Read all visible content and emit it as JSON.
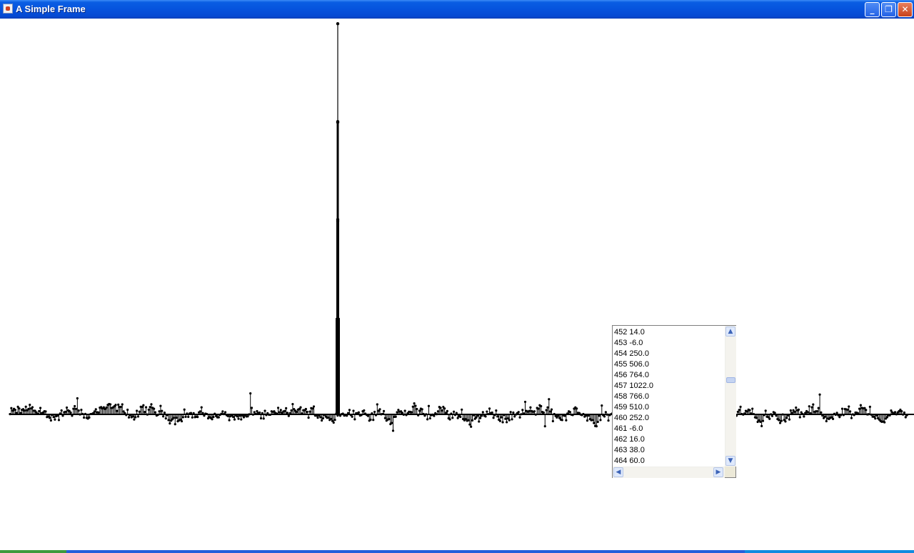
{
  "window": {
    "title": "A Simple Frame",
    "icon": "java-cup-icon",
    "controls": {
      "minimize": "_",
      "maximize": "❐",
      "close": "✕"
    }
  },
  "list": {
    "items": [
      "452 14.0",
      "453 -6.0",
      "454 250.0",
      "455 506.0",
      "456 764.0",
      "457 1022.0",
      "458 766.0",
      "459 510.0",
      "460 252.0",
      "461 -6.0",
      "462 16.0",
      "463 38.0",
      "464 60.0"
    ],
    "scroll_up": "▲",
    "scroll_down": "▼",
    "scroll_left": "◀",
    "scroll_right": "▶"
  },
  "chart_data": {
    "type": "stem",
    "baseline": 0,
    "peak": {
      "index": 457,
      "value": 1022.0
    },
    "points_in_list": [
      [
        452,
        14.0
      ],
      [
        453,
        -6.0
      ],
      [
        454,
        250.0
      ],
      [
        455,
        506.0
      ],
      [
        456,
        764.0
      ],
      [
        457,
        1022.0
      ],
      [
        458,
        766.0
      ],
      [
        459,
        510.0
      ],
      [
        460,
        252.0
      ],
      [
        461,
        -6.0
      ],
      [
        462,
        16.0
      ],
      [
        463,
        38.0
      ],
      [
        464,
        60.0
      ]
    ],
    "colors": {
      "stem": "#000000",
      "background": "#ffffff"
    }
  }
}
